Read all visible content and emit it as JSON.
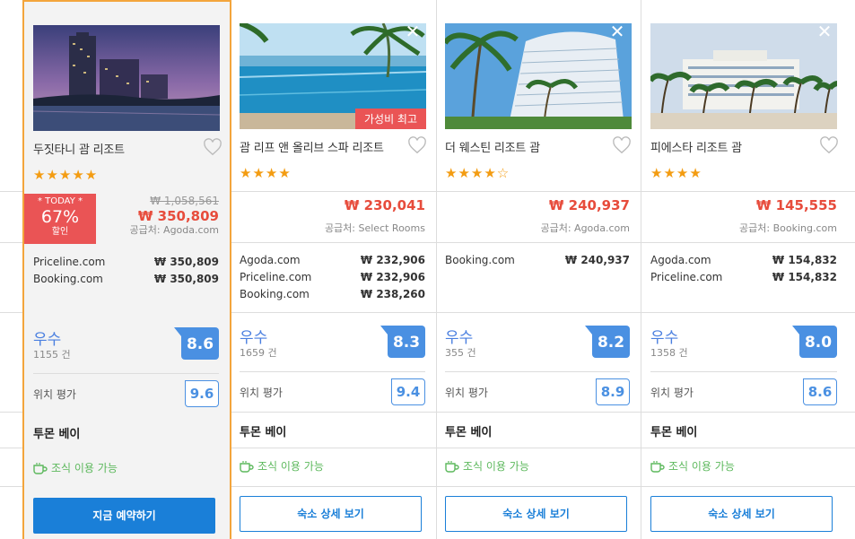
{
  "currency": "₩",
  "labels": {
    "supplier_prefix": "공급처: ",
    "location_rating": "위치 평가",
    "breakfast": "조식 이용 가능",
    "reviews_suffix": " 건"
  },
  "hotels": [
    {
      "name": "두짓타니 괌 리조트",
      "stars": "★★★★★",
      "star_rating": 5,
      "today_badge": {
        "line1": "* TODAY *",
        "percent": "67%",
        "line3": "할인"
      },
      "old_price": "₩ 1,058,561",
      "price": "₩ 350,809",
      "supplier": "공급처: Agoda.com",
      "others": [
        {
          "site": "Priceline.com",
          "price": "₩ 350,809"
        },
        {
          "site": "Booking.com",
          "price": "₩ 350,809"
        }
      ],
      "rating_word": "우수",
      "reviews": "1155 건",
      "score": "8.6",
      "location_label": "위치 평가",
      "location_score": "9.6",
      "area": "투몬 베이",
      "breakfast": "조식 이용 가능",
      "button": "지금 예약하기"
    },
    {
      "name": "괌 리프 앤 올리브 스파 리조트",
      "stars": "★★★★",
      "star_rating": 4,
      "value_badge": "가성비 최고",
      "price": "₩ 230,041",
      "supplier": "공급처: Select Rooms",
      "others": [
        {
          "site": "Agoda.com",
          "price": "₩ 232,906"
        },
        {
          "site": "Priceline.com",
          "price": "₩ 232,906"
        },
        {
          "site": "Booking.com",
          "price": "₩ 238,260"
        }
      ],
      "rating_word": "우수",
      "reviews": "1659 건",
      "score": "8.3",
      "location_label": "위치 평가",
      "location_score": "9.4",
      "area": "투몬 베이",
      "breakfast": "조식 이용 가능",
      "button": "숙소 상세 보기"
    },
    {
      "name": "더 웨스틴 리조트 괌",
      "stars": "★★★★☆",
      "star_rating": 4.5,
      "price": "₩ 240,937",
      "supplier": "공급처: Agoda.com",
      "others": [
        {
          "site": "Booking.com",
          "price": "₩ 240,937"
        }
      ],
      "rating_word": "우수",
      "reviews": "355 건",
      "score": "8.2",
      "location_label": "위치 평가",
      "location_score": "8.9",
      "area": "투몬 베이",
      "breakfast": "조식 이용 가능",
      "button": "숙소 상세 보기"
    },
    {
      "name": "피에스타 리조트 괌",
      "stars": "★★★★",
      "star_rating": 4,
      "price": "₩ 145,555",
      "supplier": "공급처: Booking.com",
      "others": [
        {
          "site": "Agoda.com",
          "price": "₩ 154,832"
        },
        {
          "site": "Priceline.com",
          "price": "₩ 154,832"
        }
      ],
      "rating_word": "우수",
      "reviews": "1358 건",
      "score": "8.0",
      "location_label": "위치 평가",
      "location_score": "8.6",
      "area": "투몬 베이",
      "breakfast": "조식 이용 가능",
      "button": "숙소 상세 보기"
    }
  ],
  "colors": {
    "highlight_border": "#f3a53c",
    "price_red": "#e74c3c",
    "score_blue": "#4a90e2",
    "breakfast_green": "#5cb85c",
    "primary_button": "#1a7fd8"
  }
}
